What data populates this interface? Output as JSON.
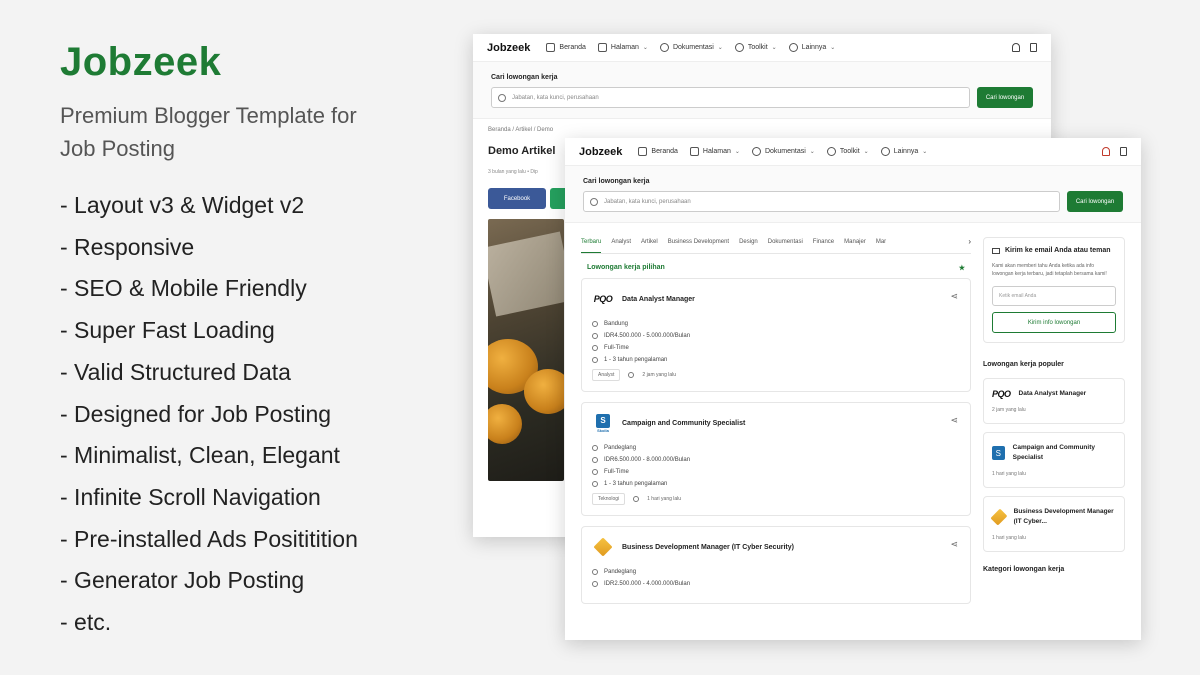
{
  "promo": {
    "brand": "Jobzeek",
    "tagline": "Premium Blogger Template for Job Posting",
    "features": [
      "- Layout v3 & Widget v2",
      "- Responsive",
      "- SEO & Mobile Friendly",
      "- Super Fast Loading",
      "- Valid Structured Data",
      "- Designed for Job Posting",
      "- Minimalist, Clean, Elegant",
      "- Infinite Scroll Navigation",
      "- Pre-installed Ads Posititition",
      "- Generator Job Posting",
      "- etc."
    ]
  },
  "nav": {
    "logo": "Jobzeek",
    "items": [
      "Beranda",
      "Halaman",
      "Dokumentasi",
      "Toolkit",
      "Lainnya"
    ]
  },
  "search": {
    "title": "Cari lowongan kerja",
    "placeholder": "Jabatan, kata kunci, perusahaan",
    "button": "Cari lowongan"
  },
  "article": {
    "crumb": "Beranda  /  Artikel  /  Demo",
    "title": "Demo Artikel",
    "meta": "3 bulan yang lalu  •  Dip",
    "facebook": "Facebook"
  },
  "tabs": [
    "Terbaru",
    "Analyst",
    "Artikel",
    "Business Development",
    "Design",
    "Dokumentasi",
    "Finance",
    "Manajer",
    "Mar"
  ],
  "featured_label": "Lowongan kerja pilihan",
  "jobs": [
    {
      "logo": "PQO",
      "title": "Data Analyst Manager",
      "location": "Bandung",
      "salary": "IDR4.500.000 - 5.000.000/Bulan",
      "type": "Full-Time",
      "experience": "1 - 3 tahun pengalaman",
      "tag": "Analyst",
      "time": "2 jam yang lalu"
    },
    {
      "logo": "S",
      "logo_caption": "Skolla",
      "title": "Campaign and Community Specialist",
      "location": "Pandeglang",
      "salary": "IDR6.500.000 - 8.000.000/Bulan",
      "type": "Full-Time",
      "experience": "1 - 3 tahun pengalaman",
      "tag": "Teknologi",
      "time": "1 hari yang lalu"
    },
    {
      "title": "Business Development Manager (IT Cyber Security)",
      "location": "Pandeglang",
      "salary": "IDR2.500.000 - 4.000.000/Bulan"
    }
  ],
  "subscribe": {
    "title": "Kirim ke email Anda atau teman",
    "text": "Kami akan memberi tahu Anda ketika ada info lowongan kerja terbaru, jadi tetaplah bersama kami!",
    "placeholder": "Ketik email Anda",
    "button": "Kirim info lowongan"
  },
  "popular": {
    "title": "Lowongan kerja populer",
    "items": [
      {
        "title": "Data Analyst Manager",
        "time": "2 jam yang lalu"
      },
      {
        "title": "Campaign and Community Specialist",
        "time": "1 hari yang lalu"
      },
      {
        "title": "Business Development Manager (IT Cyber...",
        "time": "1 hari yang lalu"
      }
    ]
  },
  "categories_title": "Kategori lowongan kerja",
  "colors": {
    "accent": "#1e7b34",
    "facebook": "#3b5998",
    "whatsapp": "#25a05e"
  }
}
